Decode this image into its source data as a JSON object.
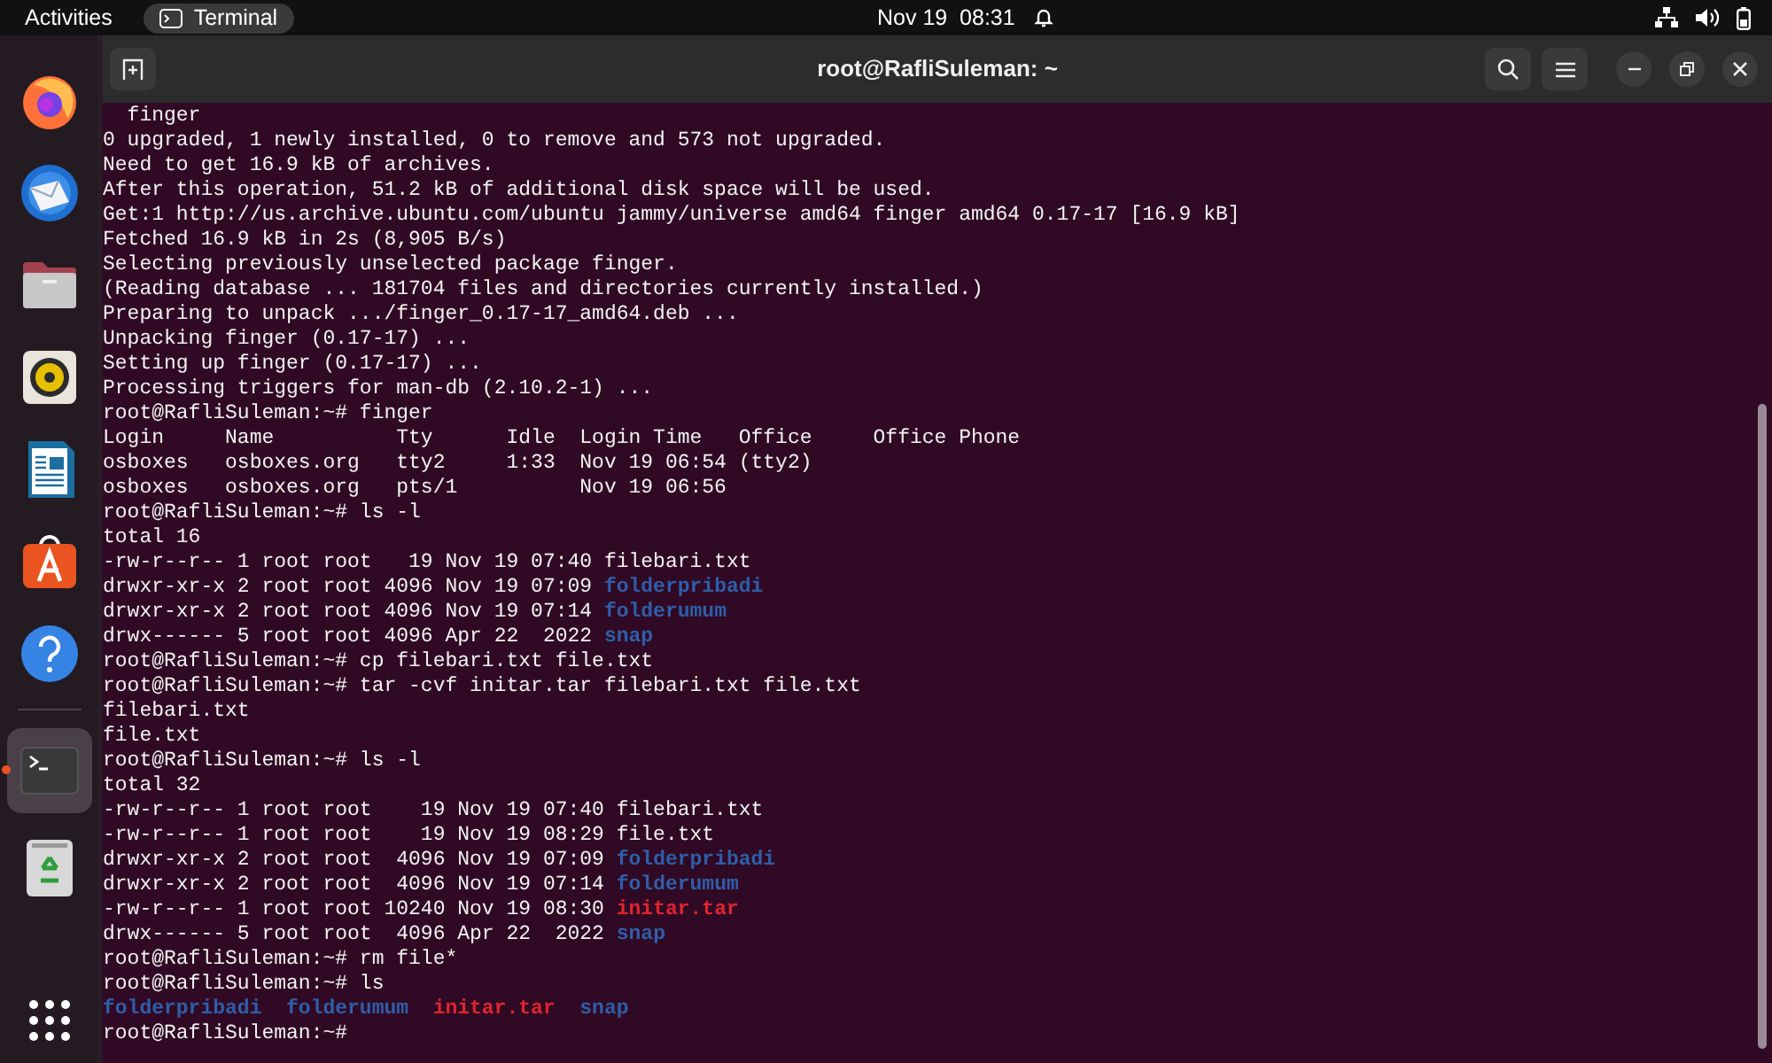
{
  "top_bar": {
    "activities": "Activities",
    "app_menu": "Terminal",
    "clock": "Nov 19  08:31"
  },
  "dock": {
    "apps": [
      {
        "kind": "firefox",
        "running": false
      },
      {
        "kind": "mail",
        "running": false
      },
      {
        "kind": "files",
        "running": false
      },
      {
        "kind": "music",
        "running": false
      },
      {
        "kind": "writer",
        "running": false
      },
      {
        "kind": "software",
        "running": false
      },
      {
        "kind": "help",
        "running": false
      },
      {
        "kind": "terminal",
        "running": true
      },
      {
        "kind": "trash",
        "running": false
      }
    ]
  },
  "window": {
    "title": "root@RafliSuleman: ~"
  },
  "terminal": {
    "lines": [
      [
        {
          "text": "  finger",
          "kind": "plain"
        }
      ],
      [
        {
          "text": "0 upgraded, 1 newly installed, 0 to remove and 573 not upgraded.",
          "kind": "plain"
        }
      ],
      [
        {
          "text": "Need to get 16.9 kB of archives.",
          "kind": "plain"
        }
      ],
      [
        {
          "text": "After this operation, 51.2 kB of additional disk space will be used.",
          "kind": "plain"
        }
      ],
      [
        {
          "text": "Get:1 http://us.archive.ubuntu.com/ubuntu jammy/universe amd64 finger amd64 0.17-17 [16.9 kB]",
          "kind": "plain"
        }
      ],
      [
        {
          "text": "Fetched 16.9 kB in 2s (8,905 B/s)",
          "kind": "plain"
        }
      ],
      [
        {
          "text": "Selecting previously unselected package finger.",
          "kind": "plain"
        }
      ],
      [
        {
          "text": "(Reading database ... 181704 files and directories currently installed.)",
          "kind": "plain"
        }
      ],
      [
        {
          "text": "Preparing to unpack .../finger_0.17-17_amd64.deb ...",
          "kind": "plain"
        }
      ],
      [
        {
          "text": "Unpacking finger (0.17-17) ...",
          "kind": "plain"
        }
      ],
      [
        {
          "text": "Setting up finger (0.17-17) ...",
          "kind": "plain"
        }
      ],
      [
        {
          "text": "Processing triggers for man-db (2.10.2-1) ...",
          "kind": "plain"
        }
      ],
      [
        {
          "text": "root@RafliSuleman:~# finger",
          "kind": "plain"
        }
      ],
      [
        {
          "text": "Login     Name          Tty      Idle  Login Time   Office     Office Phone",
          "kind": "plain"
        }
      ],
      [
        {
          "text": "osboxes   osboxes.org   tty2     1:33  Nov 19 06:54 (tty2)",
          "kind": "plain"
        }
      ],
      [
        {
          "text": "osboxes   osboxes.org   pts/1          Nov 19 06:56",
          "kind": "plain"
        }
      ],
      [
        {
          "text": "root@RafliSuleman:~# ls -l",
          "kind": "plain"
        }
      ],
      [
        {
          "text": "total 16",
          "kind": "plain"
        }
      ],
      [
        {
          "text": "-rw-r--r-- 1 root root   19 Nov 19 07:40 filebari.txt",
          "kind": "plain"
        }
      ],
      [
        {
          "text": "drwxr-xr-x 2 root root 4096 Nov 19 07:09 ",
          "kind": "plain"
        },
        {
          "text": "folderpribadi",
          "kind": "dir"
        }
      ],
      [
        {
          "text": "drwxr-xr-x 2 root root 4096 Nov 19 07:14 ",
          "kind": "plain"
        },
        {
          "text": "folderumum",
          "kind": "dir"
        }
      ],
      [
        {
          "text": "drwx------ 5 root root 4096 Apr 22  2022 ",
          "kind": "plain"
        },
        {
          "text": "snap",
          "kind": "dir"
        }
      ],
      [
        {
          "text": "root@RafliSuleman:~# cp filebari.txt file.txt",
          "kind": "plain"
        }
      ],
      [
        {
          "text": "root@RafliSuleman:~# tar -cvf initar.tar filebari.txt file.txt",
          "kind": "plain"
        }
      ],
      [
        {
          "text": "filebari.txt",
          "kind": "plain"
        }
      ],
      [
        {
          "text": "file.txt",
          "kind": "plain"
        }
      ],
      [
        {
          "text": "root@RafliSuleman:~# ls -l",
          "kind": "plain"
        }
      ],
      [
        {
          "text": "total 32",
          "kind": "plain"
        }
      ],
      [
        {
          "text": "-rw-r--r-- 1 root root    19 Nov 19 07:40 filebari.txt",
          "kind": "plain"
        }
      ],
      [
        {
          "text": "-rw-r--r-- 1 root root    19 Nov 19 08:29 file.txt",
          "kind": "plain"
        }
      ],
      [
        {
          "text": "drwxr-xr-x 2 root root  4096 Nov 19 07:09 ",
          "kind": "plain"
        },
        {
          "text": "folderpribadi",
          "kind": "dir"
        }
      ],
      [
        {
          "text": "drwxr-xr-x 2 root root  4096 Nov 19 07:14 ",
          "kind": "plain"
        },
        {
          "text": "folderumum",
          "kind": "dir"
        }
      ],
      [
        {
          "text": "-rw-r--r-- 1 root root 10240 Nov 19 08:30 ",
          "kind": "plain"
        },
        {
          "text": "initar.tar",
          "kind": "archive"
        }
      ],
      [
        {
          "text": "drwx------ 5 root root  4096 Apr 22  2022 ",
          "kind": "plain"
        },
        {
          "text": "snap",
          "kind": "dir"
        }
      ],
      [
        {
          "text": "root@RafliSuleman:~# rm file*",
          "kind": "plain"
        }
      ],
      [
        {
          "text": "root@RafliSuleman:~# ls",
          "kind": "plain"
        }
      ],
      [
        {
          "text": "folderpribadi",
          "kind": "dir"
        },
        {
          "text": "folderumum",
          "kind": "dir",
          "spaced": true
        },
        {
          "text": "initar.tar",
          "kind": "archive",
          "spaced": true
        },
        {
          "text": "snap",
          "kind": "dir",
          "spaced": true
        }
      ],
      [
        {
          "text": "root@RafliSuleman:~# ",
          "kind": "plain"
        }
      ]
    ]
  }
}
